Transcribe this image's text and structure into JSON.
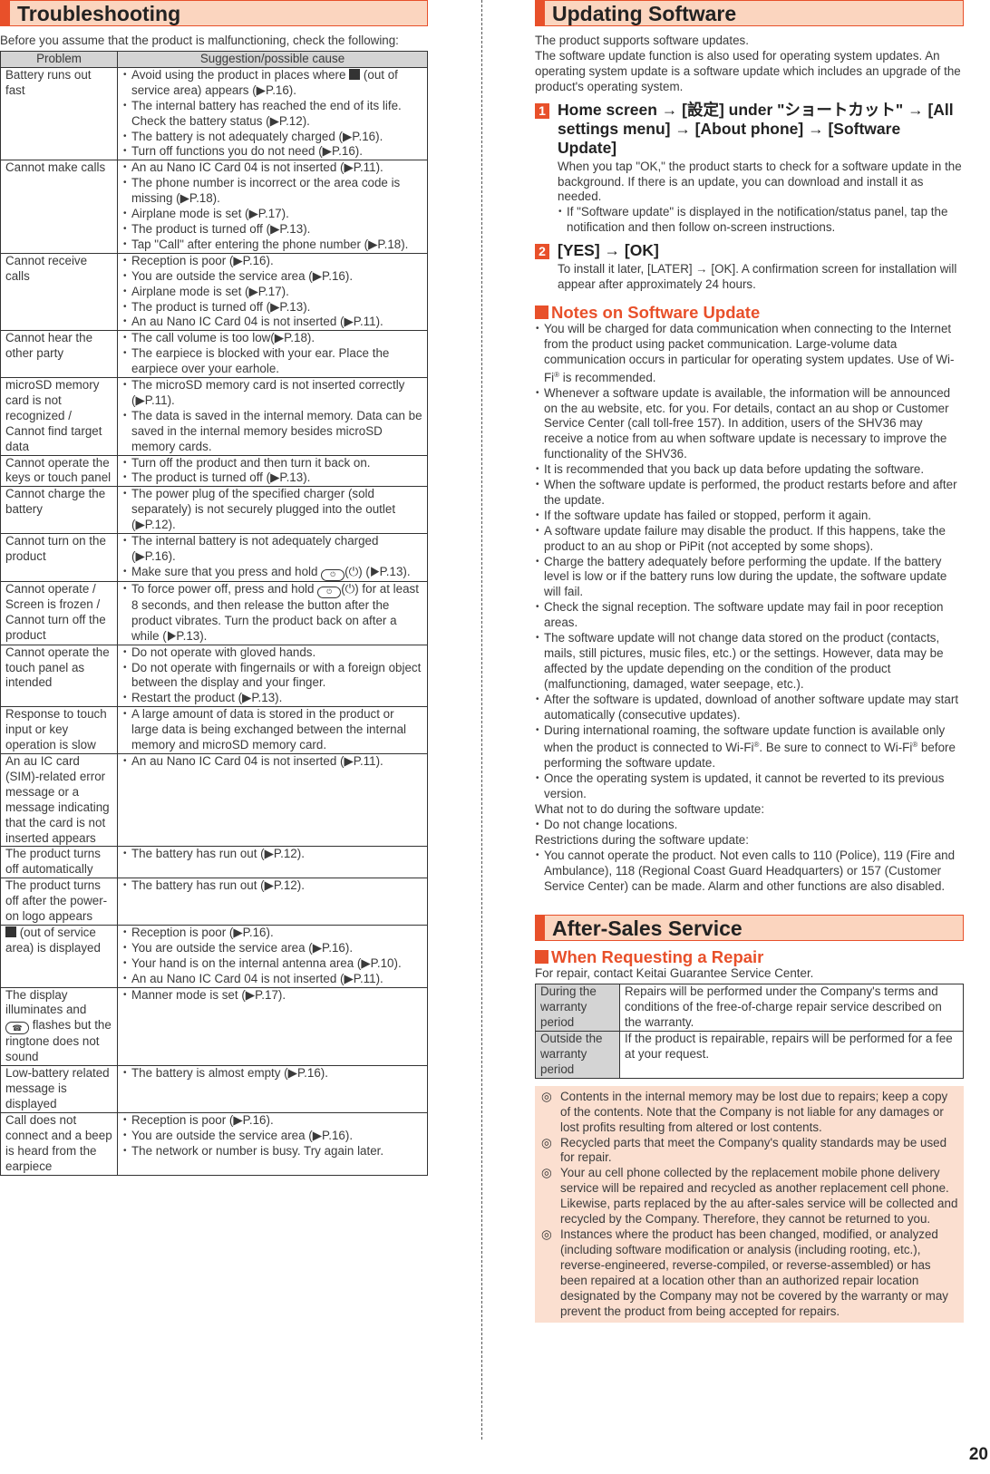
{
  "troubleshooting": {
    "title": "Troubleshooting",
    "intro": "Before you assume that the product is malfunctioning, check the following:",
    "headers": {
      "problem": "Problem",
      "suggestion": "Suggestion/possible cause"
    },
    "rows": [
      {
        "problem": "Battery runs out fast",
        "causes": [
          "Avoid using the product in places where [out-of-service-icon] (out of service area) appears (▶P.16).",
          "The internal battery has reached the end of its life. Check the battery status (▶P.12).",
          "The battery is not adequately charged (▶P.16).",
          "Turn off functions you do not need (▶P.16)."
        ]
      },
      {
        "problem": "Cannot make calls",
        "causes": [
          "An au Nano IC Card 04 is not inserted (▶P.11).",
          "The phone number is incorrect or the area code is missing (▶P.18).",
          "Airplane mode is set (▶P.17).",
          "The product is turned off (▶P.13).",
          "Tap \"Call\" after entering the phone number (▶P.18)."
        ]
      },
      {
        "problem": "Cannot receive calls",
        "causes": [
          "Reception is poor (▶P.16).",
          "You are outside the service area (▶P.16).",
          "Airplane mode is set (▶P.17).",
          "The product is turned off (▶P.13).",
          "An au Nano IC Card 04 is not inserted (▶P.11)."
        ]
      },
      {
        "problem": "Cannot hear the other party",
        "causes": [
          "The call volume is too low(▶P.18).",
          "The earpiece is blocked with your ear. Place the earpiece over your earhole."
        ]
      },
      {
        "problem": "microSD memory card is not recognized / Cannot find target data",
        "causes": [
          "The microSD memory card is not inserted correctly (▶P.11).",
          "The data is saved in the internal memory. Data can be saved in the internal memory besides microSD memory cards."
        ]
      },
      {
        "problem": "Cannot operate the keys or touch panel",
        "causes": [
          "Turn off the product and then turn it back on.",
          "The product is turned off (▶P.13)."
        ]
      },
      {
        "problem": "Cannot charge the battery",
        "causes": [
          "The power plug of the specified charger (sold separately) is not securely plugged into the outlet (▶P.12)."
        ]
      },
      {
        "problem": "Cannot turn on the product",
        "causes": [
          "The internal battery is not adequately charged (▶P.16).",
          "Make sure that you press and hold [power-key-icon](⏻) (▶P.13)."
        ]
      },
      {
        "problem": "Cannot operate / Screen is frozen / Cannot turn off the product",
        "causes": [
          "To force power off, press and hold [power-key-icon](⏻) for at least 8 seconds, and then release the button after the product vibrates. Turn the product back on after a while (▶P.13)."
        ]
      },
      {
        "problem": "Cannot operate the touch panel as intended",
        "causes": [
          "Do not operate with gloved hands.",
          "Do not operate with fingernails or with a foreign object between the display and your finger.",
          "Restart the product (▶P.13)."
        ]
      },
      {
        "problem": "Response to touch input or key operation is slow",
        "causes": [
          "A large amount of data is stored in the product or large data is being exchanged between the internal memory and microSD memory card."
        ]
      },
      {
        "problem": "An au IC card (SIM)-related error message or a message indicating that the card is not inserted appears",
        "causes": [
          "An au Nano IC Card 04 is not inserted (▶P.11)."
        ]
      },
      {
        "problem": "The product turns off automatically",
        "causes": [
          "The battery has run out (▶P.12)."
        ]
      },
      {
        "problem": "The product turns off after the power-on logo appears",
        "causes": [
          "The battery has run out (▶P.12)."
        ]
      },
      {
        "problem": "[out-of-service-icon] (out of service area) is displayed",
        "causes": [
          "Reception is poor (▶P.16).",
          "You are outside the service area (▶P.16).",
          "Your hand is on the internal antenna area (▶P.10).",
          "An au Nano IC Card 04 is not inserted (▶P.11)."
        ]
      },
      {
        "problem": "The display illuminates and [phone-lamp-icon] flashes but the ringtone does not sound",
        "causes": [
          "Manner mode is set (▶P.17)."
        ]
      },
      {
        "problem": "Low-battery related message is displayed",
        "causes": [
          "The battery is almost empty (▶P.16)."
        ]
      },
      {
        "problem": "Call does not connect and a beep is heard from the earpiece",
        "causes": [
          "Reception is poor (▶P.16).",
          "You are outside the service area (▶P.16).",
          "The network or number is busy. Try again later."
        ]
      }
    ]
  },
  "updating": {
    "title": "Updating Software",
    "intro": [
      "The product supports software updates.",
      "The software update function is also used for operating system updates. An operating system update is a software update which includes an upgrade of the product's operating system."
    ],
    "steps": [
      {
        "num": "1",
        "title": "Home screen → [設定] under \"ショートカット\" → [All settings menu] → [About phone] → [Software Update]",
        "body": "When you tap \"OK,\" the product starts to check for a software update in the background. If there is an update, you can download and install it as needed.",
        "bullets": [
          "If \"Software update\" is displayed in the notification/status panel, tap the notification and then follow on-screen instructions."
        ]
      },
      {
        "num": "2",
        "title": "[YES] → [OK]",
        "body": "To install it later, [LATER] → [OK]. A confirmation screen for installation will appear after approximately 24 hours.",
        "bullets": []
      }
    ],
    "notes_title": "Notes on Software Update",
    "notes": [
      "You will be charged for data communication when connecting to the Internet from the product using packet communication. Large-volume data communication occurs in particular for operating system updates. Use of Wi-Fi® is recommended.",
      "Whenever a software update is available, the information will be announced on the au website, etc. for you. For details, contact an au shop or Customer Service Center (call toll-free 157). In addition, users of the SHV36 may receive a notice from au when software update is necessary to improve the functionality of the SHV36.",
      "It is recommended that you back up data before updating the software.",
      "When the software update is performed, the product restarts before and after the update.",
      "If the software update has failed or stopped, perform it again.",
      "A software update failure may disable the product. If this happens, take the product to an au shop or PiPit (not accepted by some shops).",
      "Charge the battery adequately before performing the update. If the battery level is low or if the battery runs low during the update, the software update will fail.",
      "Check the signal reception. The software update may fail in poor reception areas.",
      "The software update will not change data stored on the product (contacts, mails, still pictures, music files, etc.) or the settings. However, data may be affected by the update depending on the condition of the product (malfunctioning, damaged, water seepage, etc.).",
      "After the software is updated, download of another software update may start automatically (consecutive updates).",
      "During international roaming, the software update function is available only when the product is connected to Wi-Fi®. Be sure to connect to Wi-Fi® before performing the software update.",
      "Once the operating system is updated, it cannot be reverted to its previous version."
    ],
    "what_not_label": "What not to do during the software update:",
    "what_not": [
      "Do not change locations."
    ],
    "restrictions_label": "Restrictions during the software update:",
    "restrictions": [
      "You cannot operate the product. Not even calls to 110 (Police), 119 (Fire and Ambulance), 118 (Regional Coast Guard Headquarters) or 157 (Customer Service Center) can be made. Alarm and other functions are also disabled."
    ]
  },
  "after_sales": {
    "title": "After-Sales Service",
    "repair_title": "When Requesting a Repair",
    "repair_intro": "For repair, contact Keitai Guarantee Service Center.",
    "repair_table": [
      {
        "key": "During the warranty period",
        "value": "Repairs will be performed under the Company's terms and conditions of the free-of-charge repair service described on the warranty."
      },
      {
        "key": "Outside the warranty period",
        "value": "If the product is repairable, repairs will be performed for a fee at your request."
      }
    ],
    "marker": "◎",
    "notes": [
      "Contents in the internal memory may be lost due to repairs; keep a copy of the contents. Note that the Company is not liable for any damages or lost profits resulting from altered or lost contents.",
      "Recycled parts that meet the Company's quality standards may be used for repair.",
      "Your au cell phone collected by the replacement mobile phone delivery service will be repaired and recycled as another replacement cell phone. Likewise, parts replaced by the au after-sales service will be collected and recycled by the Company. Therefore, they cannot be returned to you.",
      "Instances where the product has been changed, modified, or analyzed (including software modification or analysis (including rooting, etc.), reverse-engineered, reverse-compiled, or reverse-assembled) or has been repaired at a location other than an authorized repair location designated by the Company may not be covered by the warranty or may prevent the product from being accepted for repairs."
    ]
  },
  "page_number": "20",
  "colors": {
    "accent": "#e8502a",
    "header_bg": "#fbd5bf",
    "note_bg": "#fbdfd0",
    "table_head": "#d4d4d4"
  }
}
